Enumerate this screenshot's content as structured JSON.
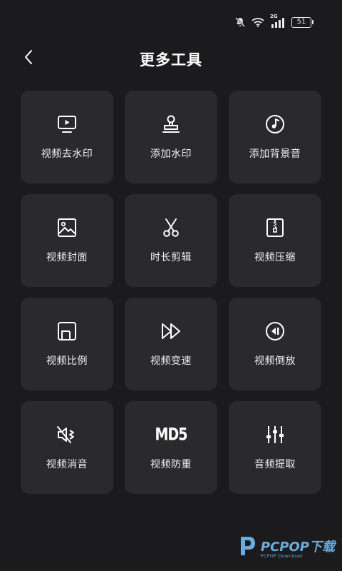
{
  "status_bar": {
    "network_label": "2G",
    "battery": "51",
    "icons": [
      "mute-bell-icon",
      "wifi-icon",
      "signal-icon",
      "battery-icon"
    ]
  },
  "header": {
    "title": "更多工具",
    "back_icon": "chevron-left-icon"
  },
  "tools": [
    {
      "label": "视频去水印",
      "icon": "tv-play-icon"
    },
    {
      "label": "添加水印",
      "icon": "stamp-icon"
    },
    {
      "label": "添加背景音",
      "icon": "music-note-icon"
    },
    {
      "label": "视频封面",
      "icon": "image-icon"
    },
    {
      "label": "时长剪辑",
      "icon": "scissors-icon"
    },
    {
      "label": "视频压缩",
      "icon": "zip-file-icon"
    },
    {
      "label": "视频比例",
      "icon": "aspect-ratio-icon"
    },
    {
      "label": "视频变速",
      "icon": "fast-forward-icon"
    },
    {
      "label": "视频倒放",
      "icon": "rewind-icon"
    },
    {
      "label": "视频消音",
      "icon": "speaker-mute-icon"
    },
    {
      "label": "视频防重",
      "icon": "md5-icon",
      "icon_text": "MD5"
    },
    {
      "label": "音频提取",
      "icon": "equalizer-icon"
    }
  ],
  "watermark": {
    "brand": "PCPOP下载",
    "sub": "PCPOP Download",
    "color": "#6fb4ea"
  },
  "colors": {
    "background": "#1b1b1d",
    "tile": "#2a2a2c",
    "text": "#ffffff"
  }
}
